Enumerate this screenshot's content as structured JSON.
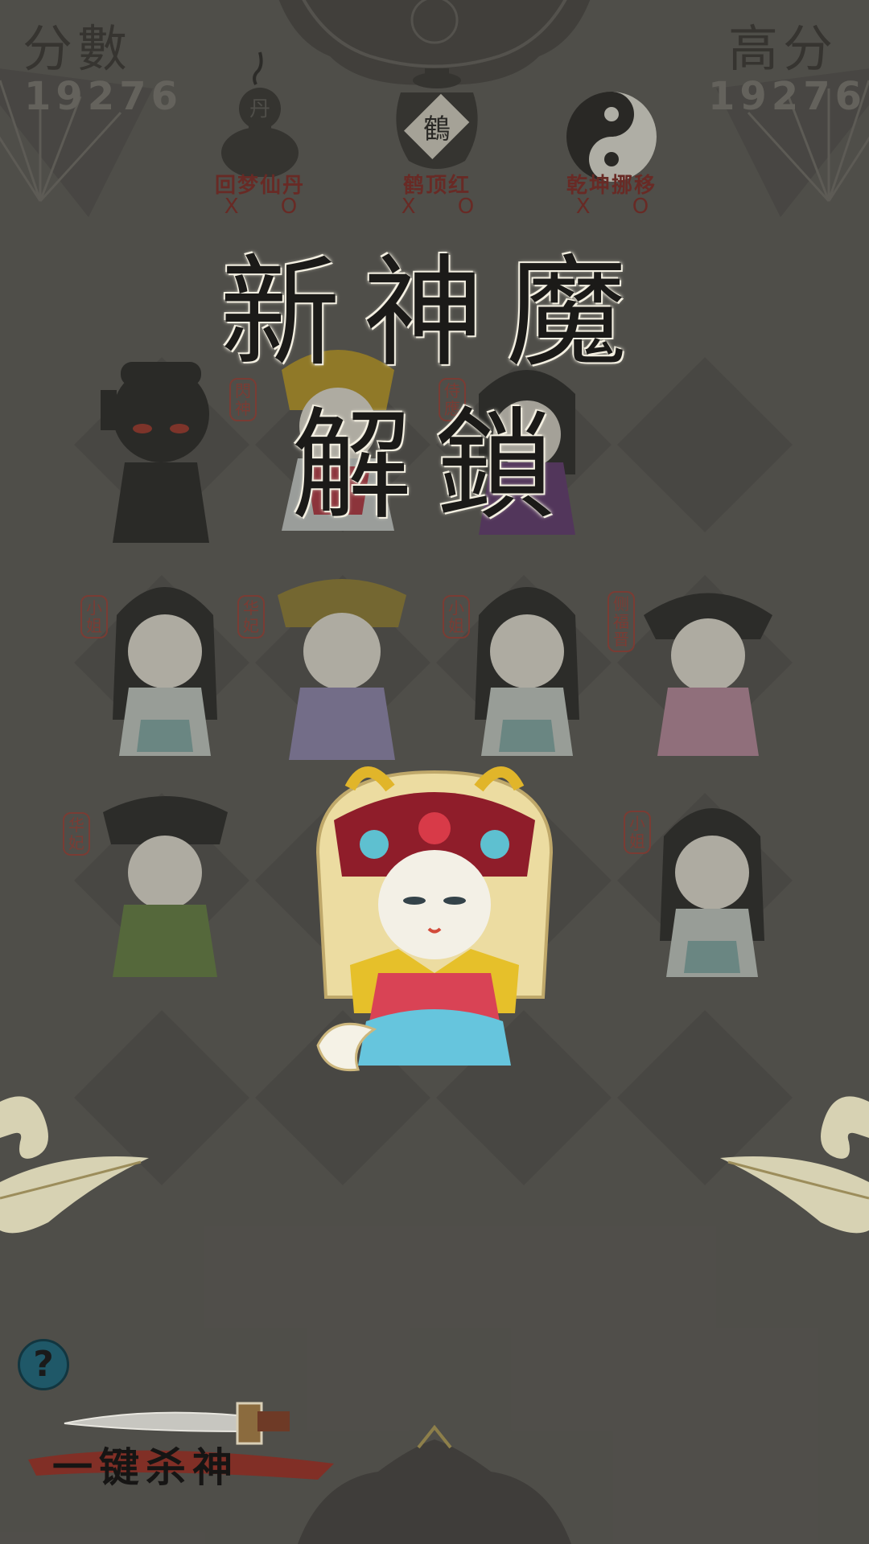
{
  "score": {
    "label": "分數",
    "value": "19276"
  },
  "high_score": {
    "label": "高分",
    "value": "19276"
  },
  "powerups": [
    {
      "name": "回梦仙丹",
      "count": "X O",
      "icon": "gourd-icon"
    },
    {
      "name": "鹤顶红",
      "count": "X O",
      "icon": "poison-jar-icon",
      "jar_char": "鶴"
    },
    {
      "name": "乾坤挪移",
      "count": "X O",
      "icon": "yin-yang-icon"
    }
  ],
  "unlock_banner": {
    "line1": "新神魔",
    "line2": "解鎖"
  },
  "board": {
    "seals": {
      "r0c1": "閃神",
      "r0c2": "侍應",
      "r1c0": "小姐",
      "r1c1": "华妃",
      "r1c2": "小姐",
      "r1c3": "侧福晋",
      "r2c0": "华妃",
      "r2c3": "小姐"
    }
  },
  "help_button": {
    "label": "?"
  },
  "kill_all_button": {
    "label": "一键杀神"
  },
  "colors": {
    "background": "#55534f",
    "tile": "#4b4946",
    "seal_red": "#a83228",
    "item_red": "#7c1c17"
  }
}
